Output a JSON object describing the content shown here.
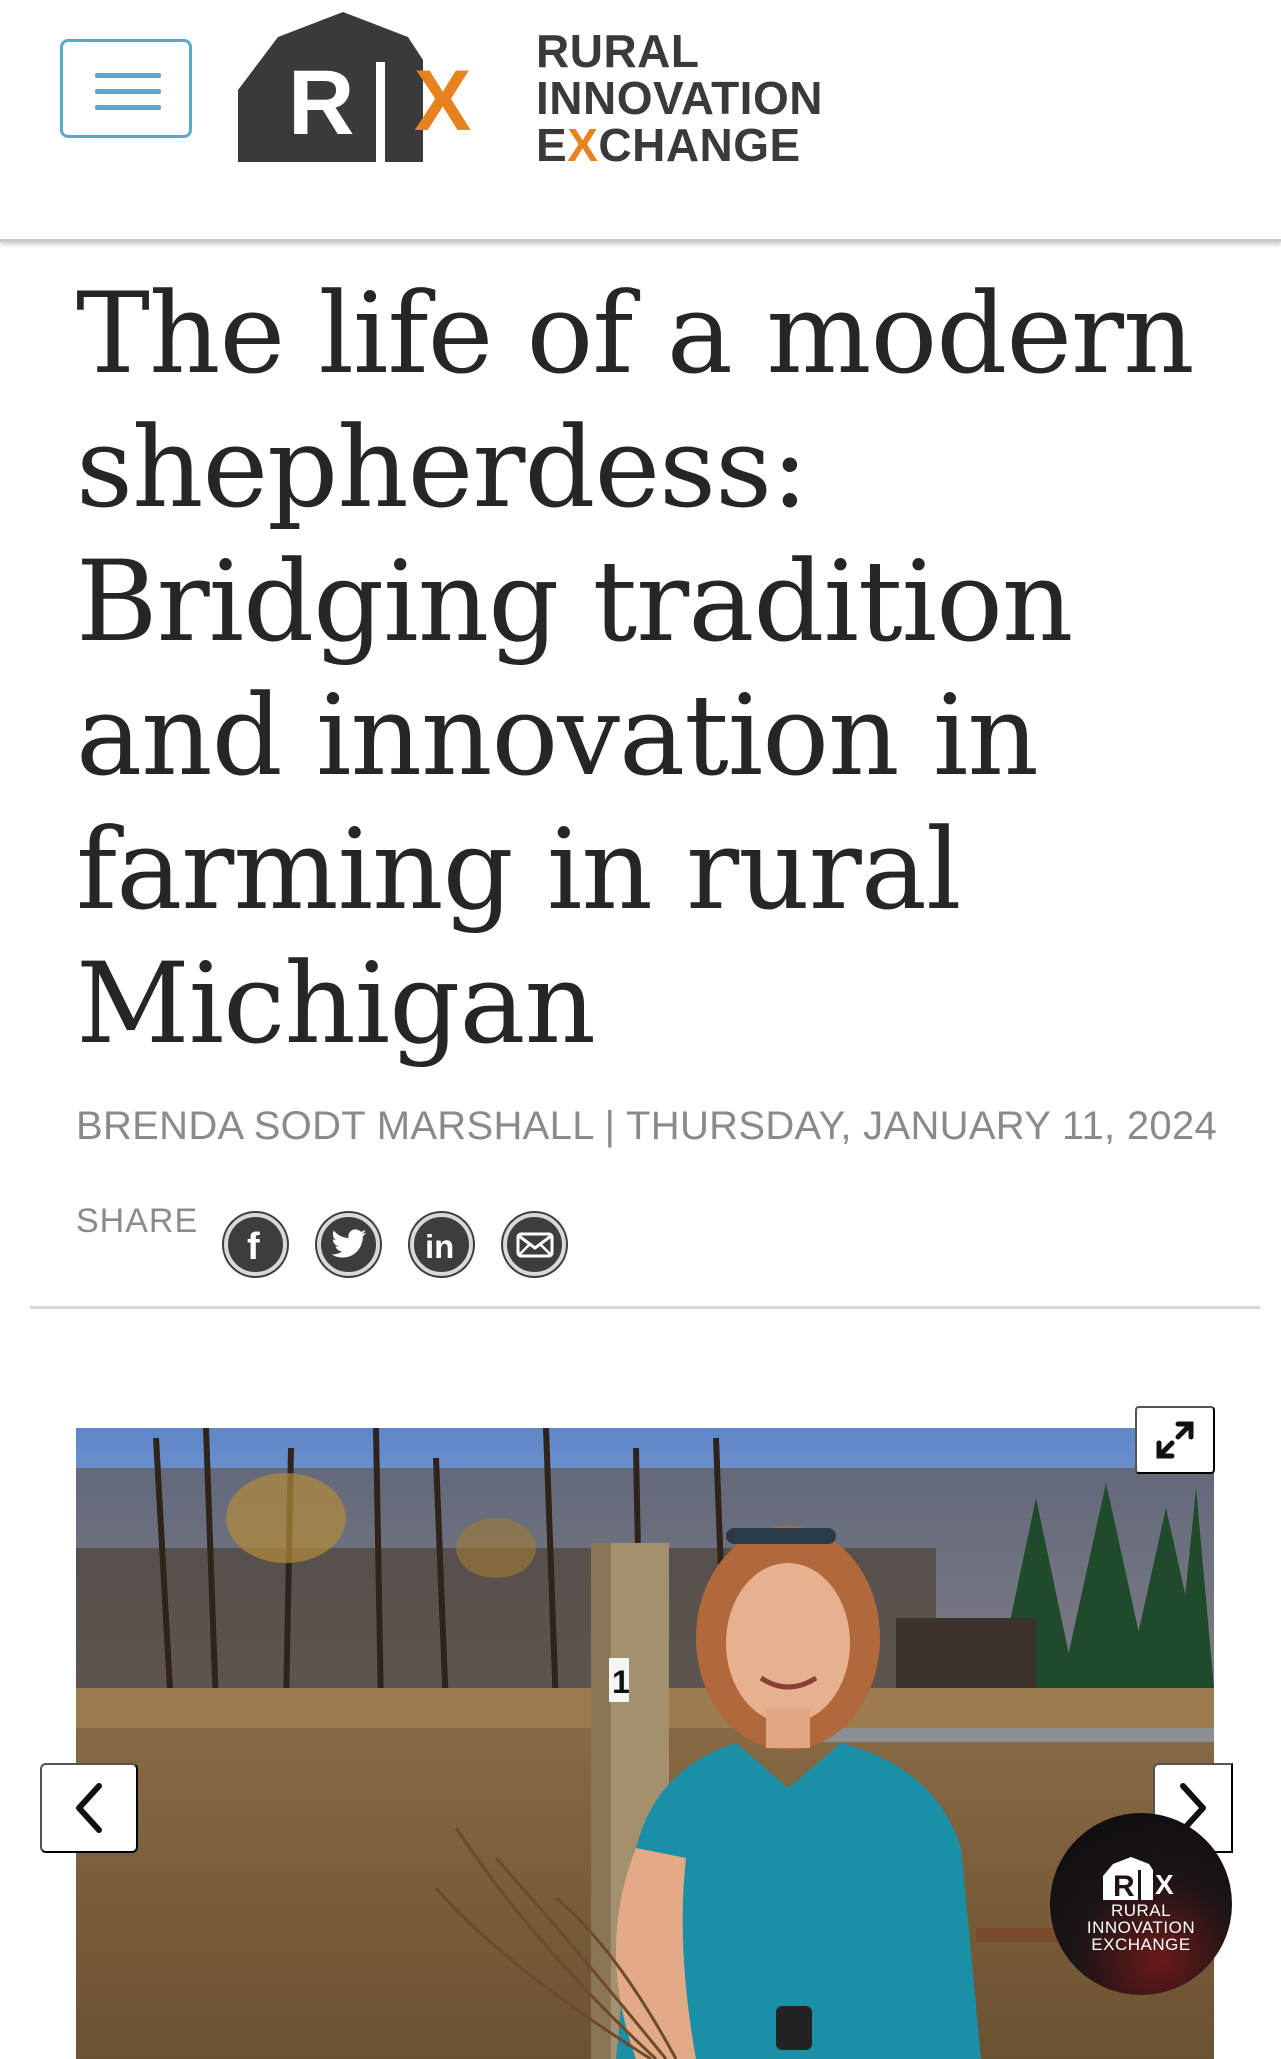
{
  "header": {
    "menu_icon": "hamburger-menu-icon",
    "logo": {
      "mark_letters": "R|X",
      "line1": "RURAL",
      "line2": "INNOVATION",
      "line3_a": "E",
      "line3_x": "X",
      "line3_b": "CHANGE",
      "brand_dark": "#3a3a3a",
      "brand_orange": "#e8821f"
    }
  },
  "article": {
    "title": "The life of a modern shepherdess: Bridging tradition and innovation in farming in rural Michigan",
    "byline": "BRENDA SODT MARSHALL | THURSDAY, JANUARY 11, 2024",
    "share_label": "SHARE",
    "share_icons": [
      "facebook-icon",
      "twitter-icon",
      "linkedin-icon",
      "email-icon"
    ]
  },
  "gallery": {
    "expand_icon": "expand-icon",
    "prev_icon": "chevron-left-icon",
    "next_icon": "chevron-right-icon",
    "post_number": "1",
    "badge": {
      "line1": "RURAL",
      "line2": "INNOVATION",
      "line3": "EXCHANGE"
    }
  },
  "colors": {
    "accent_blue": "#5aa9c9",
    "title_text": "#262626",
    "meta_text": "#8a8a8a"
  }
}
